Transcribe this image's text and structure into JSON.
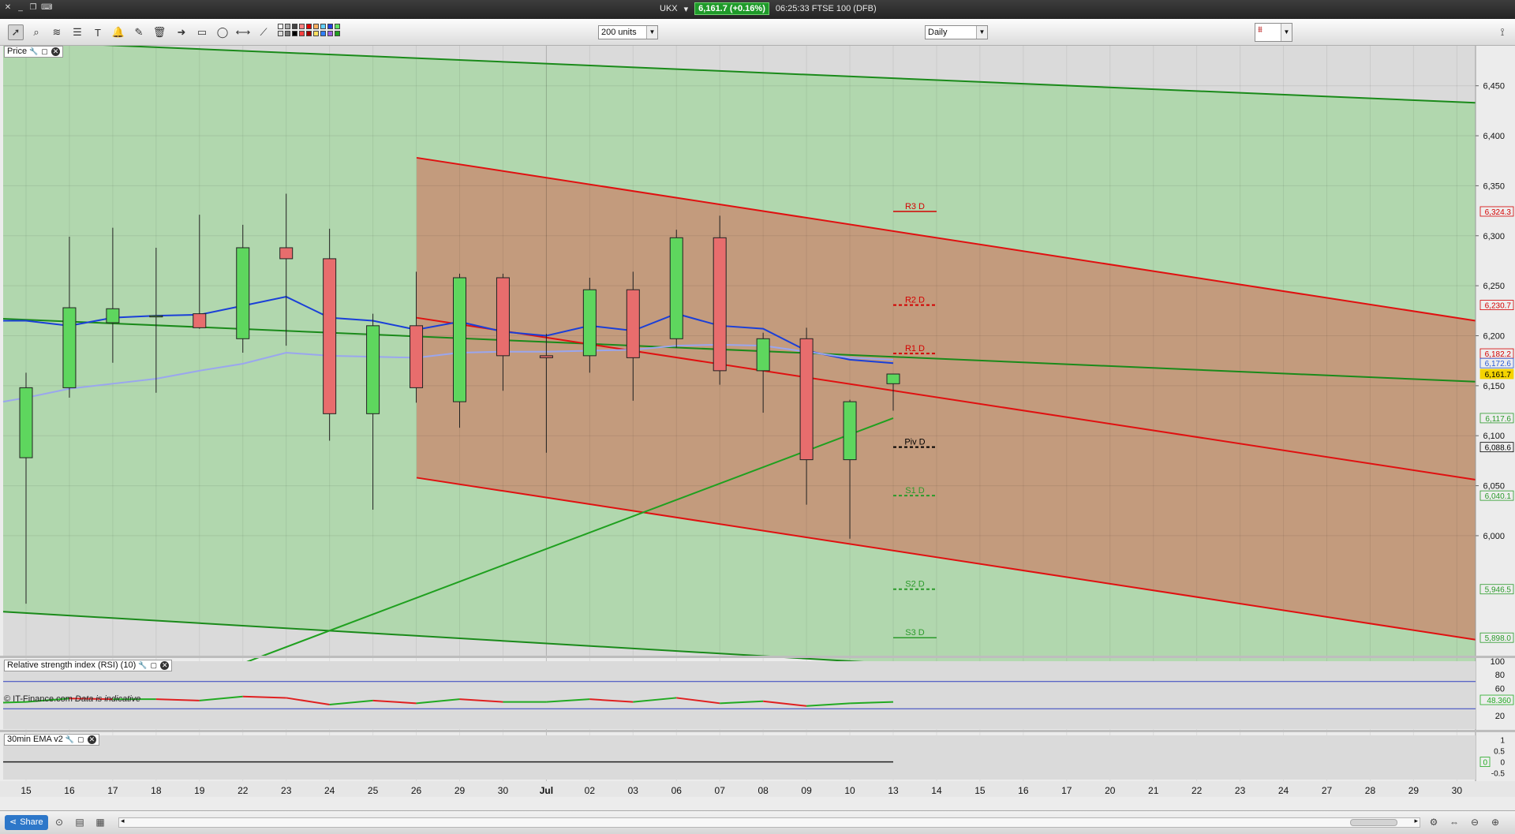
{
  "titlebar": {
    "instrument": "UKX",
    "price_badge": "6,161.7 (+0.16%)",
    "time_desc": "06:25:33 FTSE 100 (DFB)"
  },
  "toolbar": {
    "units_value": "200 units",
    "interval_value": "Daily",
    "tools": [
      "pointer-icon",
      "zoom-icon",
      "fib-icon",
      "text-icon",
      "alert-icon",
      "ruler-icon",
      "trash-icon",
      "arrow-icon",
      "rectangle-icon",
      "ellipse-icon",
      "hline-icon",
      "trendline-icon"
    ],
    "colors": [
      "#ffffff",
      "#dddddd",
      "#aaaaaa",
      "#777777",
      "#444444",
      "#000000",
      "#ff8080",
      "#ff4040",
      "#e00000",
      "#a00000",
      "#ffb060",
      "#ffe060",
      "#60d0ff",
      "#3080ff",
      "#2040e0",
      "#a060e0",
      "#60e060",
      "#20a020"
    ]
  },
  "panels": {
    "price_label": "Price",
    "rsi_label": "Relative strength index (RSI) (10)",
    "ema_label": "30min EMA v2",
    "copyright": "© IT-Finance.com",
    "indicative": "Data is indicative"
  },
  "chart_data": {
    "type": "candlestick",
    "x_labels": [
      "15",
      "16",
      "17",
      "18",
      "19",
      "22",
      "23",
      "24",
      "25",
      "26",
      "29",
      "30",
      "Jul",
      "02",
      "03",
      "06",
      "07",
      "08",
      "09",
      "10",
      "13",
      "14",
      "15",
      "16",
      "17",
      "20",
      "21",
      "22",
      "23",
      "24",
      "27",
      "28",
      "29",
      "30"
    ],
    "y_ticks": [
      6000,
      6050,
      6100,
      6150,
      6200,
      6250,
      6300,
      6350,
      6400,
      6450
    ],
    "y_tick_labels": [
      "6,000",
      "6,050",
      "6,100",
      "6,150",
      "6,200",
      "6,250",
      "6,300",
      "6,350",
      "6,400",
      "6,450"
    ],
    "ylim": [
      5880,
      6490
    ],
    "candles": [
      {
        "x": "15",
        "open": 6078,
        "high": 6163,
        "low": 5932,
        "close": 6148
      },
      {
        "x": "16",
        "open": 6148,
        "high": 6299,
        "low": 6138,
        "close": 6228
      },
      {
        "x": "17",
        "open": 6213,
        "high": 6308,
        "low": 6173,
        "close": 6227
      },
      {
        "x": "18",
        "open": 6220,
        "high": 6288,
        "low": 6143,
        "close": 6220
      },
      {
        "x": "19",
        "open": 6222,
        "high": 6321,
        "low": 6207,
        "close": 6208
      },
      {
        "x": "22",
        "open": 6197,
        "high": 6311,
        "low": 6183,
        "close": 6288
      },
      {
        "x": "23",
        "open": 6288,
        "high": 6342,
        "low": 6190,
        "close": 6277
      },
      {
        "x": "24",
        "open": 6277,
        "high": 6307,
        "low": 6095,
        "close": 6122
      },
      {
        "x": "25",
        "open": 6122,
        "high": 6222,
        "low": 6026,
        "close": 6210
      },
      {
        "x": "26",
        "open": 6210,
        "high": 6264,
        "low": 6133,
        "close": 6148
      },
      {
        "x": "29",
        "open": 6134,
        "high": 6262,
        "low": 6108,
        "close": 6258
      },
      {
        "x": "30",
        "open": 6258,
        "high": 6262,
        "low": 6145,
        "close": 6180
      },
      {
        "x": "Jul",
        "open": 6180,
        "high": 6202,
        "low": 6083,
        "close": 6178
      },
      {
        "x": "02",
        "open": 6180,
        "high": 6258,
        "low": 6163,
        "close": 6246
      },
      {
        "x": "03",
        "open": 6246,
        "high": 6264,
        "low": 6135,
        "close": 6178
      },
      {
        "x": "06",
        "open": 6197,
        "high": 6306,
        "low": 6188,
        "close": 6298
      },
      {
        "x": "07",
        "open": 6298,
        "high": 6320,
        "low": 6151,
        "close": 6165
      },
      {
        "x": "08",
        "open": 6165,
        "high": 6203,
        "low": 6123,
        "close": 6197
      },
      {
        "x": "09",
        "open": 6197,
        "high": 6208,
        "low": 6031,
        "close": 6076
      },
      {
        "x": "10",
        "open": 6076,
        "high": 6136,
        "low": 5997,
        "close": 6134
      },
      {
        "x": "13",
        "open": 6152,
        "high": 6162,
        "low": 6125,
        "close": 6161.7
      }
    ],
    "ma_fast": [
      6215,
      6210,
      6218,
      6220,
      6221,
      6230,
      6239,
      6218,
      6215,
      6206,
      6214,
      6204,
      6200,
      6210,
      6205,
      6222,
      6210,
      6207,
      6185,
      6176,
      6172.6
    ],
    "ma_slow": [
      6138,
      6147,
      6152,
      6157,
      6165,
      6172,
      6183,
      6180,
      6179,
      6178,
      6183,
      6184,
      6184,
      6185,
      6186,
      6190,
      6191,
      6190,
      6184,
      6178,
      6176
    ],
    "pivots": [
      {
        "label": "R3 D",
        "value": 6324.3,
        "value_label": "6,324.3",
        "color": "#d40000",
        "solid": true
      },
      {
        "label": "R2 D",
        "value": 6230.7,
        "value_label": "6,230.7",
        "color": "#d40000",
        "solid": false
      },
      {
        "label": "R1 D",
        "value": 6182.2,
        "value_label": "6,182.2",
        "color": "#d40000",
        "solid": false
      },
      {
        "label": "Piv D",
        "value": 6088.6,
        "value_label": "6,088.6",
        "color": "#000000",
        "solid": false
      },
      {
        "label": "S1 D",
        "value": 6040.1,
        "value_label": "6,040.1",
        "color": "#2a9a2a",
        "solid": false
      },
      {
        "label": "S2 D",
        "value": 5946.5,
        "value_label": "5,946.5",
        "color": "#2a9a2a",
        "solid": false
      },
      {
        "label": "S3 D",
        "value": 5898.0,
        "value_label": "5,898.0",
        "color": "#2a9a2a",
        "solid": true
      }
    ],
    "right_labels": [
      {
        "text": "6,172.6",
        "value": 6172.6,
        "color": "#2b5cd6"
      },
      {
        "text": "6,161.7",
        "value": 6161.7,
        "color": "#f5d400"
      },
      {
        "text": "6,117.6",
        "value": 6117.6,
        "color": "#2a9a2a"
      }
    ],
    "rsi": {
      "y_tick_labels": [
        "100",
        "80",
        "60",
        "40",
        "20"
      ],
      "levels": [
        70,
        30
      ],
      "values": [
        40,
        45,
        44,
        44,
        42,
        48,
        46,
        36,
        42,
        38,
        44,
        40,
        40,
        44,
        40,
        46,
        38,
        41,
        34,
        38,
        40
      ],
      "current_label": "48.360"
    },
    "ema": {
      "y_tick_labels": [
        "1",
        "0.5",
        "0",
        "-0.5"
      ],
      "current_label": "0"
    }
  },
  "statusbar": {
    "share_label": "Share"
  }
}
